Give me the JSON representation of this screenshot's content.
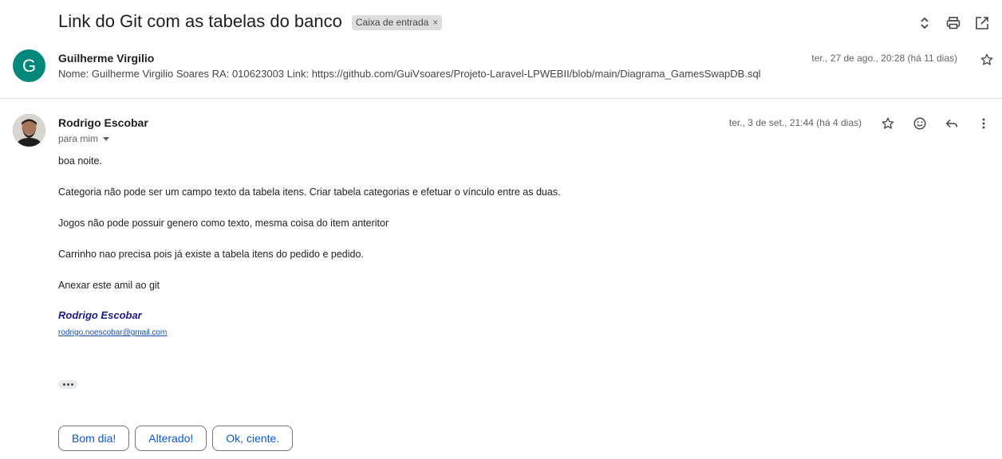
{
  "thread": {
    "subject": "Link do Git com as tabelas do banco",
    "label": "Caixa de entrada",
    "label_close": "×"
  },
  "toolbar": {
    "icons": [
      "expand-collapse-icon",
      "print-icon",
      "open-new-window-icon"
    ]
  },
  "message1": {
    "avatar_letter": "G",
    "avatar_color": "#00897b",
    "sender": "Guilherme Virgilio",
    "snippet": "Nome: Guilherme Virgilio Soares RA: 010623003 Link: https://github.com/GuiVsoares/Projeto-Laravel-LPWEBII/blob/main/Diagrama_GamesSwapDB.sql",
    "date": "ter., 27 de ago., 20:28 (há 11 dias)"
  },
  "message2": {
    "sender": "Rodrigo Escobar",
    "recipient": "para mim",
    "date": "ter., 3 de set., 21:44 (há 4 dias)",
    "body": [
      "boa noite.",
      "Categoria não pode ser um campo texto da tabela itens. Criar tabela categorias e efetuar o vínculo entre as duas.",
      "Jogos não pode possuir genero como texto, mesma coisa do item anteritor",
      "Carrinho nao precisa pois já existe a tabela itens do pedido e pedido.",
      "Anexar este amil ao git"
    ],
    "signature_name": "Rodrigo Escobar",
    "signature_email": "rodrigo.noescobar@gmail.com"
  },
  "smart_replies": [
    "Bom dia!",
    "Alterado!",
    "Ok, ciente."
  ],
  "colors": {
    "accent": "#0b57d0",
    "signature": "#1a1a8c"
  }
}
